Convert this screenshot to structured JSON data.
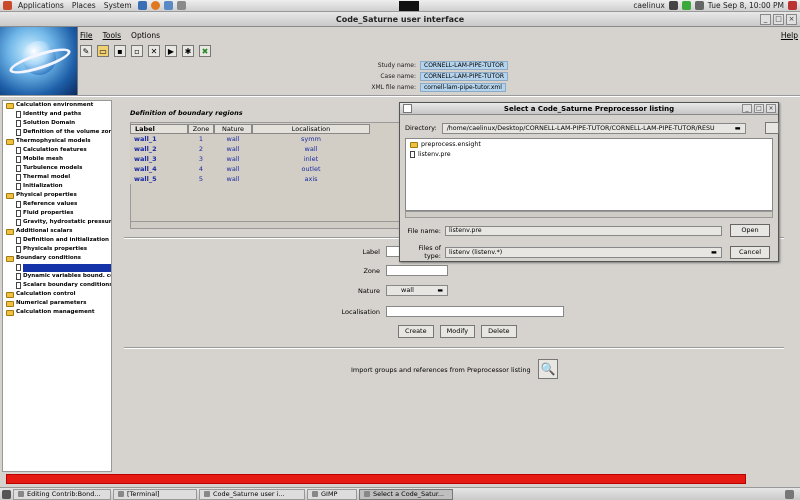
{
  "gnome_panel": {
    "menus": [
      "Applications",
      "Places",
      "System"
    ],
    "user": "caelinux",
    "clock": "Tue Sep  8, 10:00 PM"
  },
  "window": {
    "title": "Code_Saturne user interface",
    "controls": [
      "_",
      "□",
      "×"
    ]
  },
  "menubar": {
    "file": "File",
    "tools": "Tools",
    "options": "Options",
    "help": "Help"
  },
  "toolbar_icons": [
    "new-file-icon",
    "open-folder-icon",
    "save-icon",
    "save-as-icon",
    "preprocess-icon",
    "run-icon",
    "close-icon"
  ],
  "study": {
    "study_label": "Study name:",
    "study_value": "CORNELL-LAM-PIPE-TUTOR",
    "case_label": "Case name:",
    "case_value": "CORNELL-LAM-PIPE-TUTOR",
    "xml_label": "XML file name:",
    "xml_value": "cornell-lam-pipe-tutor.xml"
  },
  "tree": [
    {
      "label": "Calculation environment",
      "level": 0
    },
    {
      "label": "Identity and paths",
      "level": 1
    },
    {
      "label": "Solution Domain",
      "level": 1
    },
    {
      "label": "Definition of the volume zones",
      "level": 1
    },
    {
      "label": "Thermophysical models",
      "level": 0
    },
    {
      "label": "Calculation features",
      "level": 1
    },
    {
      "label": "Mobile mesh",
      "level": 1
    },
    {
      "label": "Turbulence models",
      "level": 1
    },
    {
      "label": "Thermal model",
      "level": 1
    },
    {
      "label": "Initialization",
      "level": 1
    },
    {
      "label": "Physical properties",
      "level": 0
    },
    {
      "label": "Reference values",
      "level": 1
    },
    {
      "label": "Fluid properties",
      "level": 1
    },
    {
      "label": "Gravity, hydrostatic pressure",
      "level": 1
    },
    {
      "label": "Additional scalars",
      "level": 0
    },
    {
      "label": "Definition and initialization",
      "level": 1
    },
    {
      "label": "Physicals properties",
      "level": 1
    },
    {
      "label": "Boundary conditions",
      "level": 0
    },
    {
      "label": "",
      "level": 1,
      "selected": true
    },
    {
      "label": "Dynamic variables bound. cond.",
      "level": 1
    },
    {
      "label": "Scalars boundary conditions",
      "level": 1
    },
    {
      "label": "Calculation control",
      "level": 0
    },
    {
      "label": "Numerical parameters",
      "level": 0
    },
    {
      "label": "Calculation management",
      "level": 0
    }
  ],
  "boundary": {
    "title": "Definition of boundary regions",
    "headers": [
      "Label",
      "Zone",
      "Nature",
      "Localisation"
    ],
    "rows": [
      [
        "wall_1",
        "1",
        "wall",
        "symm"
      ],
      [
        "wall_2",
        "2",
        "wall",
        "wall"
      ],
      [
        "wall_3",
        "3",
        "wall",
        "inlet"
      ],
      [
        "wall_4",
        "4",
        "wall",
        "outlet"
      ],
      [
        "wall_5",
        "5",
        "wall",
        "axis"
      ]
    ]
  },
  "form": {
    "label_lbl": "Label",
    "zone_lbl": "Zone",
    "nature_lbl": "Nature",
    "nature_value": "wall",
    "localisation_lbl": "Localisation",
    "create": "Create",
    "modify": "Modify",
    "delete": "Delete",
    "import_label": "Import groups and references from Preprocessor listing"
  },
  "dialog": {
    "title": "Select a Code_Saturne Preprocessor listing",
    "directory_label": "Directory:",
    "directory_value": "/home/caelinux/Desktop/CORNELL-LAM-PIPE-TUTOR/CORNELL-LAM-PIPE-TUTOR/RESU",
    "files": [
      {
        "name": "preprocess.ensight",
        "kind": "folder"
      },
      {
        "name": "listenv.pre",
        "kind": "file"
      }
    ],
    "filename_label": "File name:",
    "filename_value": "listenv.pre",
    "filetype_label": "Files of type:",
    "filetype_value": "listenv (listenv.*)",
    "open": "Open",
    "cancel": "Cancel"
  },
  "progress_fraction": 0.93,
  "taskbar": [
    "Editing Contrib:Bond...",
    "[Terminal]",
    "Code_Saturne user i...",
    "GIMP",
    "Select a Code_Satur..."
  ]
}
